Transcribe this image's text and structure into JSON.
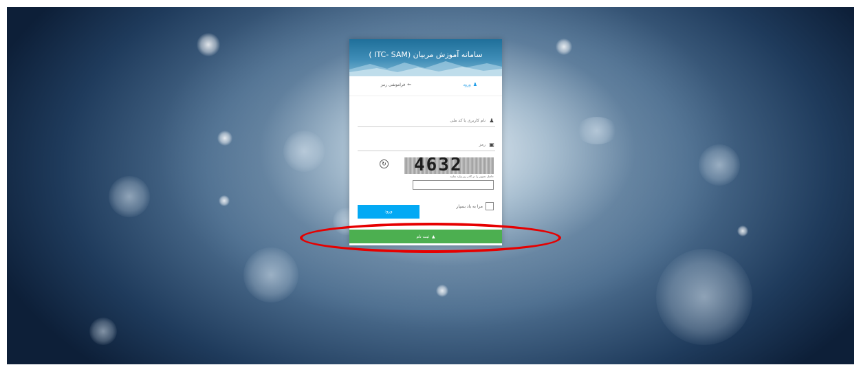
{
  "header": {
    "title": "سامانه آموزش مربیان (ITC- SAM )"
  },
  "tabs": {
    "login": "ورود",
    "forgot_password": "فراموشی رمز"
  },
  "form": {
    "username_placeholder": "نام کاربری یا کد ملی",
    "password_placeholder": "رمز",
    "captcha_value": "4632",
    "captcha_hint": "حاصل تصویر را در کادر زیر وارد نمایید",
    "remember_me_label": "مرا به یاد بسپار",
    "login_button_label": "ورود"
  },
  "register": {
    "label": "ثبت نام"
  },
  "icons": {
    "login_tab": "user-icon",
    "forgot_tab": "key-icon",
    "username": "user-icon",
    "password": "lock-icon",
    "captcha_refresh": "refresh-icon",
    "register": "graduation-cap-icon"
  },
  "colors": {
    "login_button": "#03a9f4",
    "register_button": "#4caf50",
    "active_tab": "#1a9be8",
    "highlight": "#e60000"
  }
}
